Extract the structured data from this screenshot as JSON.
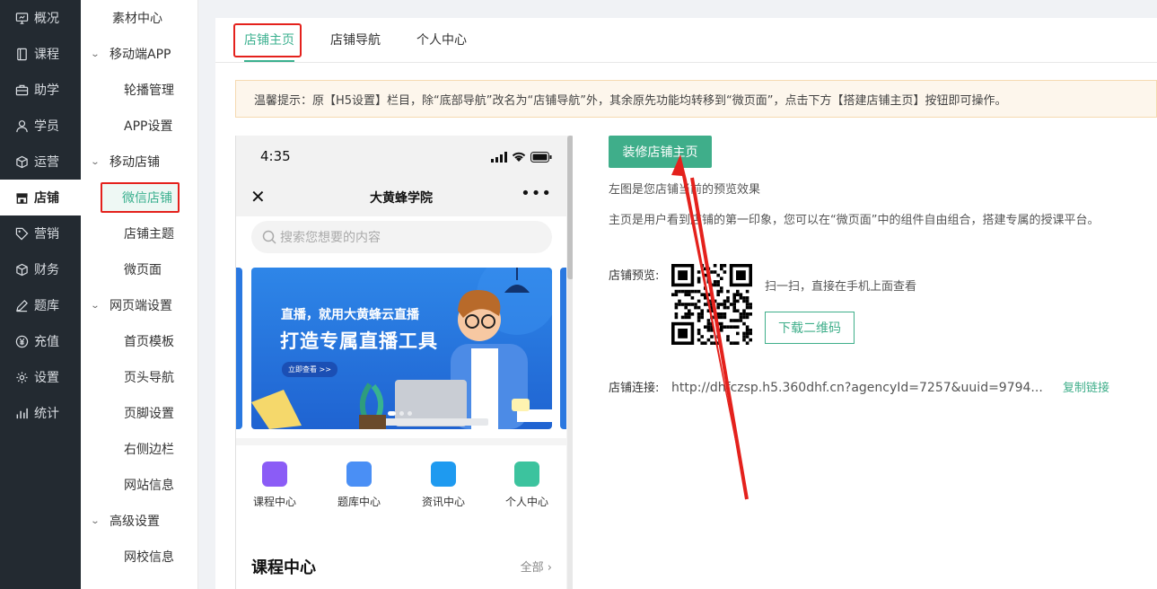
{
  "primary_nav": [
    {
      "label": "概况",
      "icon": "monitor-icon"
    },
    {
      "label": "课程",
      "icon": "book-icon"
    },
    {
      "label": "助学",
      "icon": "briefcase-icon"
    },
    {
      "label": "学员",
      "icon": "user-icon"
    },
    {
      "label": "运营",
      "icon": "cube-icon"
    },
    {
      "label": "店铺",
      "icon": "store-icon",
      "active": true
    },
    {
      "label": "营销",
      "icon": "tag-icon"
    },
    {
      "label": "财务",
      "icon": "wallet-icon"
    },
    {
      "label": "题库",
      "icon": "pen-icon"
    },
    {
      "label": "充值",
      "icon": "yen-icon"
    },
    {
      "label": "设置",
      "icon": "gear-icon"
    },
    {
      "label": "统计",
      "icon": "bar-chart-icon"
    }
  ],
  "secondary_nav": [
    {
      "label": "素材中心",
      "kind": "top"
    },
    {
      "label": "移动端APP",
      "kind": "group"
    },
    {
      "label": "轮播管理",
      "kind": "sub"
    },
    {
      "label": "APP设置",
      "kind": "sub"
    },
    {
      "label": "移动店铺",
      "kind": "group"
    },
    {
      "label": "微信店铺",
      "kind": "sub",
      "selected": true
    },
    {
      "label": "店铺主题",
      "kind": "sub"
    },
    {
      "label": "微页面",
      "kind": "sub"
    },
    {
      "label": "网页端设置",
      "kind": "group"
    },
    {
      "label": "首页模板",
      "kind": "sub"
    },
    {
      "label": "页头导航",
      "kind": "sub"
    },
    {
      "label": "页脚设置",
      "kind": "sub"
    },
    {
      "label": "右侧边栏",
      "kind": "sub"
    },
    {
      "label": "网站信息",
      "kind": "sub"
    },
    {
      "label": "高级设置",
      "kind": "group"
    },
    {
      "label": "网校信息",
      "kind": "sub"
    }
  ],
  "tabs": {
    "home": "店铺主页",
    "nav": "店铺导航",
    "personal": "个人中心"
  },
  "tip": "温馨提示：原【H5设置】栏目，除“底部导航”改名为“店铺导航”外，其余原先功能均转移到“微页面”，点击下方【搭建店铺主页】按钮即可操作。",
  "phone": {
    "time": "4:35",
    "title": "大黄蜂学院",
    "search_placeholder": "搜索您想要的内容",
    "banner_line1": "直播，就用大黄蜂云直播",
    "banner_line2": "打造专属直播工具",
    "banner_button": "立即查看 >>",
    "quick_icons": [
      {
        "label": "课程中心",
        "color": "#8b5cf6",
        "icon": "tv-icon"
      },
      {
        "label": "题库中心",
        "color": "#4a8ff5",
        "icon": "book-open-icon"
      },
      {
        "label": "资讯中心",
        "color": "#1e9af0",
        "icon": "news-icon"
      },
      {
        "label": "个人中心",
        "color": "#3cc39e",
        "icon": "bear-icon"
      }
    ],
    "section_title": "课程中心",
    "section_more": "全部"
  },
  "right": {
    "edit_button": "装修店铺主页",
    "info1": "左图是您店铺当前的预览效果",
    "info2": "主页是用户看到店铺的第一印象，您可以在“微页面”中的组件自由组合，搭建专属的授课平台。",
    "preview_label": "店铺预览:",
    "scan_text": "扫一扫，直接在手机上面查看",
    "download_button": "下载二维码",
    "link_label": "店铺连接:",
    "link_value": "http://dhfczsp.h5.360dhf.cn?agencyId=7257&uuid=9794...",
    "copy_link": "复制链接"
  },
  "colors": {
    "accent": "#3fae8a",
    "highlight": "#e4211c",
    "nav_bg": "#232a31"
  }
}
